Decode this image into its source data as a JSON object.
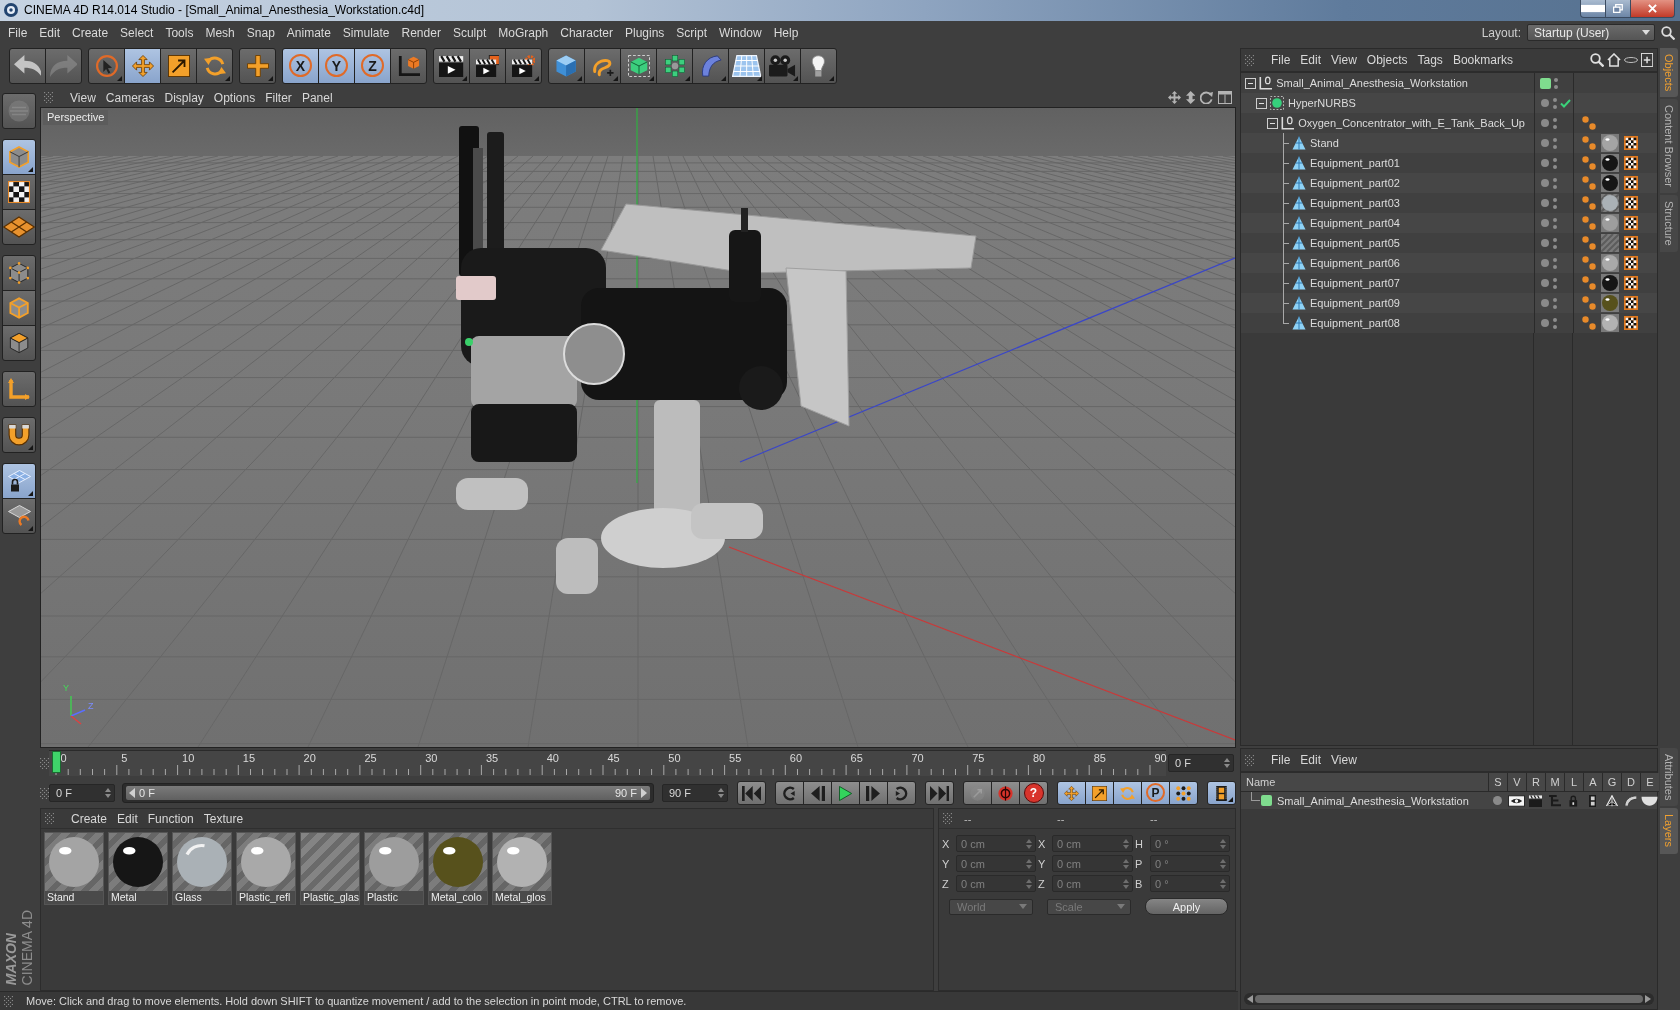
{
  "window": {
    "title": "CINEMA 4D R14.014 Studio - [Small_Animal_Anesthesia_Workstation.c4d]"
  },
  "menu_bar": {
    "items": [
      "File",
      "Edit",
      "Create",
      "Select",
      "Tools",
      "Mesh",
      "Snap",
      "Animate",
      "Simulate",
      "Render",
      "Sculpt",
      "MoGraph",
      "Character",
      "Plugins",
      "Script",
      "Window",
      "Help"
    ],
    "layout_label": "Layout:",
    "layout_value": "Startup (User)"
  },
  "toolbar": {
    "groups": [
      {
        "items": [
          {
            "kind": "undo",
            "on": false,
            "disabled": false,
            "submenu": false
          },
          {
            "kind": "redo",
            "on": false,
            "disabled": true,
            "submenu": false
          }
        ]
      },
      {
        "items": [
          {
            "kind": "select",
            "on": false,
            "disabled": false,
            "submenu": true
          },
          {
            "kind": "move",
            "on": true,
            "disabled": false,
            "submenu": false
          },
          {
            "kind": "scale",
            "on": false,
            "disabled": false,
            "submenu": false
          },
          {
            "kind": "rotate",
            "on": false,
            "disabled": false,
            "submenu": true
          }
        ]
      },
      {
        "items": [
          {
            "kind": "add",
            "on": false,
            "disabled": false,
            "submenu": true
          }
        ]
      },
      {
        "items": [
          {
            "kind": "axis-lock",
            "label": "X",
            "on": true,
            "disabled": false,
            "submenu": false
          },
          {
            "kind": "axis-lock",
            "label": "Y",
            "on": true,
            "disabled": false,
            "submenu": false
          },
          {
            "kind": "axis-lock",
            "label": "Z",
            "on": true,
            "disabled": false,
            "submenu": false
          },
          {
            "kind": "coordinate-system",
            "on": false,
            "disabled": false,
            "submenu": false
          }
        ]
      },
      {
        "items": [
          {
            "kind": "render-view",
            "on": false,
            "disabled": false,
            "submenu": true
          },
          {
            "kind": "render-picture",
            "on": false,
            "disabled": false,
            "submenu": false
          },
          {
            "kind": "render-settings",
            "on": false,
            "disabled": false,
            "submenu": true
          }
        ]
      },
      {
        "items": [
          {
            "kind": "cube",
            "on": false,
            "disabled": false,
            "submenu": true
          },
          {
            "kind": "spline",
            "on": false,
            "disabled": false,
            "submenu": true
          },
          {
            "kind": "nurbs",
            "on": false,
            "disabled": false,
            "submenu": true
          },
          {
            "kind": "array",
            "on": false,
            "disabled": false,
            "submenu": true
          },
          {
            "kind": "deformer",
            "on": false,
            "disabled": false,
            "submenu": true
          },
          {
            "kind": "floor",
            "on": false,
            "disabled": false,
            "submenu": true
          },
          {
            "kind": "camera",
            "on": false,
            "disabled": false,
            "submenu": true
          },
          {
            "kind": "light",
            "on": false,
            "disabled": false,
            "submenu": true
          }
        ]
      }
    ]
  },
  "left_toolbar": {
    "groups": [
      {
        "items": [
          {
            "kind": "make-editable",
            "on": false,
            "disabled": true,
            "submenu": false
          }
        ]
      },
      {
        "items": [
          {
            "kind": "model",
            "on": true,
            "disabled": false,
            "submenu": true
          },
          {
            "kind": "texture",
            "on": false,
            "disabled": false,
            "submenu": false
          },
          {
            "kind": "workplane",
            "on": false,
            "disabled": false,
            "submenu": false
          }
        ]
      },
      {
        "items": [
          {
            "kind": "points",
            "on": false,
            "disabled": false,
            "submenu": false
          },
          {
            "kind": "edges",
            "on": false,
            "disabled": false,
            "submenu": false
          },
          {
            "kind": "polygons",
            "on": false,
            "disabled": false,
            "submenu": false
          }
        ]
      },
      {
        "items": [
          {
            "kind": "axis",
            "on": false,
            "disabled": false,
            "submenu": false
          }
        ]
      },
      {
        "items": [
          {
            "kind": "tweak",
            "on": false,
            "disabled": false,
            "submenu": true
          }
        ]
      },
      {
        "items": [
          {
            "kind": "snap",
            "on": true,
            "disabled": false,
            "submenu": true
          },
          {
            "kind": "snap-settings",
            "on": false,
            "disabled": false,
            "submenu": true
          }
        ]
      }
    ]
  },
  "viewport": {
    "menu": [
      "View",
      "Cameras",
      "Display",
      "Options",
      "Filter",
      "Panel"
    ],
    "camera_label": "Perspective",
    "axis_labels": [
      "Y",
      "Z"
    ]
  },
  "timeline": {
    "ruler_labels": [
      "0",
      "5",
      "10",
      "15",
      "20",
      "25",
      "30",
      "35",
      "40",
      "45",
      "50",
      "55",
      "60",
      "65",
      "70",
      "75",
      "80",
      "85",
      "90"
    ],
    "playhead": {
      "level": 0
    },
    "current_frame": "0 F"
  },
  "transport": {
    "start_field": "0 F",
    "range": {
      "start": "0 F",
      "end": "90 F",
      "level": 1
    },
    "end_field": "90 F",
    "groups": [
      {
        "items": [
          {
            "kind": "go-start",
            "on": false,
            "disabled": false,
            "submenu": false
          }
        ]
      },
      {
        "items": [
          {
            "kind": "prev-key",
            "on": false,
            "disabled": false,
            "submenu": false
          },
          {
            "kind": "prev-frame",
            "on": false,
            "disabled": false,
            "submenu": false
          },
          {
            "kind": "play",
            "on": false,
            "disabled": false,
            "submenu": false
          },
          {
            "kind": "next-frame",
            "on": false,
            "disabled": false,
            "submenu": false
          },
          {
            "kind": "next-key",
            "on": false,
            "disabled": false,
            "submenu": false
          }
        ]
      },
      {
        "items": [
          {
            "kind": "go-end",
            "on": false,
            "disabled": false,
            "submenu": false
          }
        ]
      },
      {
        "items": [
          {
            "kind": "record",
            "on": false,
            "disabled": true,
            "submenu": false
          },
          {
            "kind": "autokey",
            "on": false,
            "disabled": false,
            "submenu": false
          },
          {
            "kind": "help",
            "label": "?",
            "on": false,
            "disabled": false,
            "submenu": false
          }
        ]
      },
      {
        "items": [
          {
            "kind": "key-move",
            "on": true,
            "disabled": false,
            "submenu": false
          },
          {
            "kind": "key-scale",
            "on": true,
            "disabled": false,
            "submenu": false
          },
          {
            "kind": "key-rotate",
            "on": true,
            "disabled": false,
            "submenu": false
          },
          {
            "kind": "key-param",
            "label": "P",
            "on": true,
            "disabled": false,
            "submenu": false
          },
          {
            "kind": "key-dots",
            "on": true,
            "disabled": false,
            "submenu": false
          }
        ]
      },
      {
        "items": [
          {
            "kind": "timeline",
            "on": true,
            "disabled": false,
            "submenu": true
          }
        ]
      }
    ]
  },
  "materials": {
    "menu": [
      "Create",
      "Edit",
      "Function",
      "Texture"
    ],
    "items": [
      {
        "name": "Stand",
        "kind": "sphere",
        "color": "#a4a4a4"
      },
      {
        "name": "Metal",
        "kind": "sphere",
        "color": "#161616"
      },
      {
        "name": "Glass",
        "kind": "glass",
        "color": "#aab1b6"
      },
      {
        "name": "Plastic_refl",
        "kind": "sphere",
        "color": "#a9a9a9"
      },
      {
        "name": "Plastic_glas",
        "kind": "clear"
      },
      {
        "name": "Plastic",
        "kind": "sphere",
        "color": "#9d9d9d"
      },
      {
        "name": "Metal_colo",
        "kind": "sphere",
        "color": "#57511c"
      },
      {
        "name": "Metal_glos",
        "kind": "sphere",
        "color": "#b2b2b2"
      }
    ]
  },
  "coordinates": {
    "headers": [
      "--",
      "--",
      "--"
    ],
    "rows": [
      {
        "position_axis": "X",
        "position": "0 cm",
        "size_axis": "X",
        "size": "0 cm",
        "rotation_axis": "H",
        "rotation": "0 °",
        "disabled": true
      },
      {
        "position_axis": "Y",
        "position": "0 cm",
        "size_axis": "Y",
        "size": "0 cm",
        "rotation_axis": "P",
        "rotation": "0 °",
        "disabled": true
      },
      {
        "position_axis": "Z",
        "position": "0 cm",
        "size_axis": "Z",
        "size": "0 cm",
        "rotation_axis": "B",
        "rotation": "0 °",
        "disabled": true
      }
    ],
    "mode": {
      "value": "World",
      "disabled": true
    },
    "transform": {
      "value": "Scale",
      "disabled": true
    },
    "apply": "Apply"
  },
  "status_bar": {
    "message": "Move: Click and drag to move elements. Hold down SHIFT to quantize movement / add to the selection in point mode, CTRL to remove."
  },
  "logo": {
    "brand": "MAXON",
    "product": "CINEMA 4D"
  },
  "objects": {
    "menu": [
      "File",
      "Edit",
      "View",
      "Objects",
      "Tags",
      "Bookmarks"
    ],
    "tree": [
      {
        "name": "Small_Animal_Anesthesia_Workstation",
        "kind": "null",
        "color": "#7fdc8e",
        "expanded": true,
        "check": false,
        "phong": false,
        "uvw": false,
        "children": [
          {
            "name": "HyperNURBS",
            "kind": "nurbs",
            "expanded": true,
            "check": true,
            "phong": false,
            "uvw": false,
            "children": [
              {
                "name": "Oxygen_Concentrator_with_E_Tank_Back_Up",
                "kind": "null",
                "expanded": true,
                "check": false,
                "phong": true,
                "uvw": false,
                "children": [
                  {
                    "name": "Stand",
                    "kind": "polygon",
                    "expanded": false,
                    "check": false,
                    "phong": true,
                    "material": {
                      "kind": "sphere",
                      "color": "#a4a4a4"
                    },
                    "uvw": true
                  },
                  {
                    "name": "Equipment_part01",
                    "kind": "polygon",
                    "expanded": false,
                    "check": false,
                    "phong": true,
                    "material": {
                      "kind": "sphere",
                      "color": "#161616"
                    },
                    "uvw": true
                  },
                  {
                    "name": "Equipment_part02",
                    "kind": "polygon",
                    "expanded": false,
                    "check": false,
                    "phong": true,
                    "material": {
                      "kind": "sphere",
                      "color": "#161616"
                    },
                    "uvw": true
                  },
                  {
                    "name": "Equipment_part03",
                    "kind": "polygon",
                    "expanded": false,
                    "check": false,
                    "phong": true,
                    "material": {
                      "kind": "glass",
                      "color": "#aab1b6"
                    },
                    "uvw": true
                  },
                  {
                    "name": "Equipment_part04",
                    "kind": "polygon",
                    "expanded": false,
                    "check": false,
                    "phong": true,
                    "material": {
                      "kind": "sphere",
                      "color": "#9d9d9d"
                    },
                    "uvw": true
                  },
                  {
                    "name": "Equipment_part05",
                    "kind": "polygon",
                    "expanded": false,
                    "check": false,
                    "phong": true,
                    "material": {
                      "kind": "clear"
                    },
                    "uvw": true
                  },
                  {
                    "name": "Equipment_part06",
                    "kind": "polygon",
                    "expanded": false,
                    "check": false,
                    "phong": true,
                    "material": {
                      "kind": "sphere",
                      "color": "#a9a9a9"
                    },
                    "uvw": true
                  },
                  {
                    "name": "Equipment_part07",
                    "kind": "polygon",
                    "expanded": false,
                    "check": false,
                    "phong": true,
                    "material": {
                      "kind": "sphere",
                      "color": "#161616"
                    },
                    "uvw": true
                  },
                  {
                    "name": "Equipment_part09",
                    "kind": "polygon",
                    "expanded": false,
                    "check": false,
                    "phong": true,
                    "material": {
                      "kind": "sphere",
                      "color": "#57511c"
                    },
                    "uvw": true
                  },
                  {
                    "name": "Equipment_part08",
                    "kind": "polygon",
                    "expanded": false,
                    "check": false,
                    "phong": true,
                    "material": {
                      "kind": "sphere",
                      "color": "#b2b2b2"
                    },
                    "uvw": true
                  }
                ]
              }
            ]
          }
        ]
      }
    ]
  },
  "layers": {
    "menu": [
      "File",
      "Edit",
      "View"
    ],
    "name_column": "Name",
    "flag_columns": [
      {
        "label": "S",
        "kind": "solo"
      },
      {
        "label": "V",
        "kind": "view"
      },
      {
        "label": "R",
        "kind": "render"
      },
      {
        "label": "M",
        "kind": "manager"
      },
      {
        "label": "L",
        "kind": "lock"
      },
      {
        "label": "A",
        "kind": "animation"
      },
      {
        "label": "G",
        "kind": "generators"
      },
      {
        "label": "D",
        "kind": "deformers"
      },
      {
        "label": "E",
        "kind": "expressions"
      }
    ],
    "rows": [
      {
        "name": "Small_Animal_Anesthesia_Workstation",
        "color": "#7fdc8e",
        "flags": [
          false,
          true,
          true,
          true,
          true,
          true,
          true,
          true,
          true
        ]
      }
    ]
  },
  "side_tabs": {
    "upper": [
      {
        "label": "Objects",
        "selected": true
      },
      {
        "label": "Content Browser",
        "selected": false
      },
      {
        "label": "Structure",
        "selected": false
      }
    ],
    "lower": [
      {
        "label": "Attributes",
        "selected": false
      },
      {
        "label": "Layers",
        "selected": true
      }
    ]
  }
}
